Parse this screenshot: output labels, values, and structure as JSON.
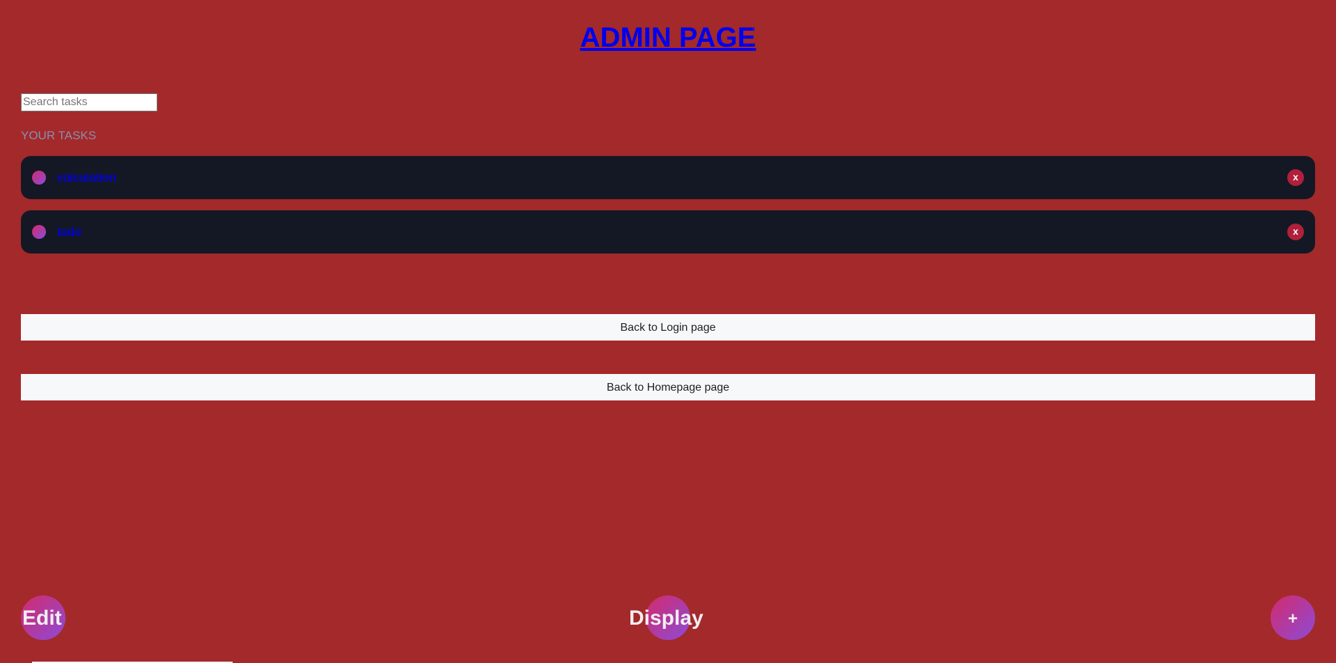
{
  "header": {
    "title": "ADMIN PAGE"
  },
  "search": {
    "placeholder": "Search tasks",
    "value": ""
  },
  "tasks_section": {
    "label": "YOUR TASKS",
    "items": [
      {
        "name": "calculation",
        "delete_label": "x"
      },
      {
        "name": "tado",
        "delete_label": "x"
      }
    ]
  },
  "nav_buttons": {
    "login": "Back to Login page",
    "homepage": "Back to Homepage page"
  },
  "fab": {
    "edit": "Edit",
    "display": "Display",
    "add": "+"
  },
  "colors": {
    "background": "#a4292b",
    "task_card": "#141824",
    "link": "#0000ee",
    "accent_gradient_start": "#d42a6a",
    "accent_gradient_end": "#8c4bd8"
  }
}
